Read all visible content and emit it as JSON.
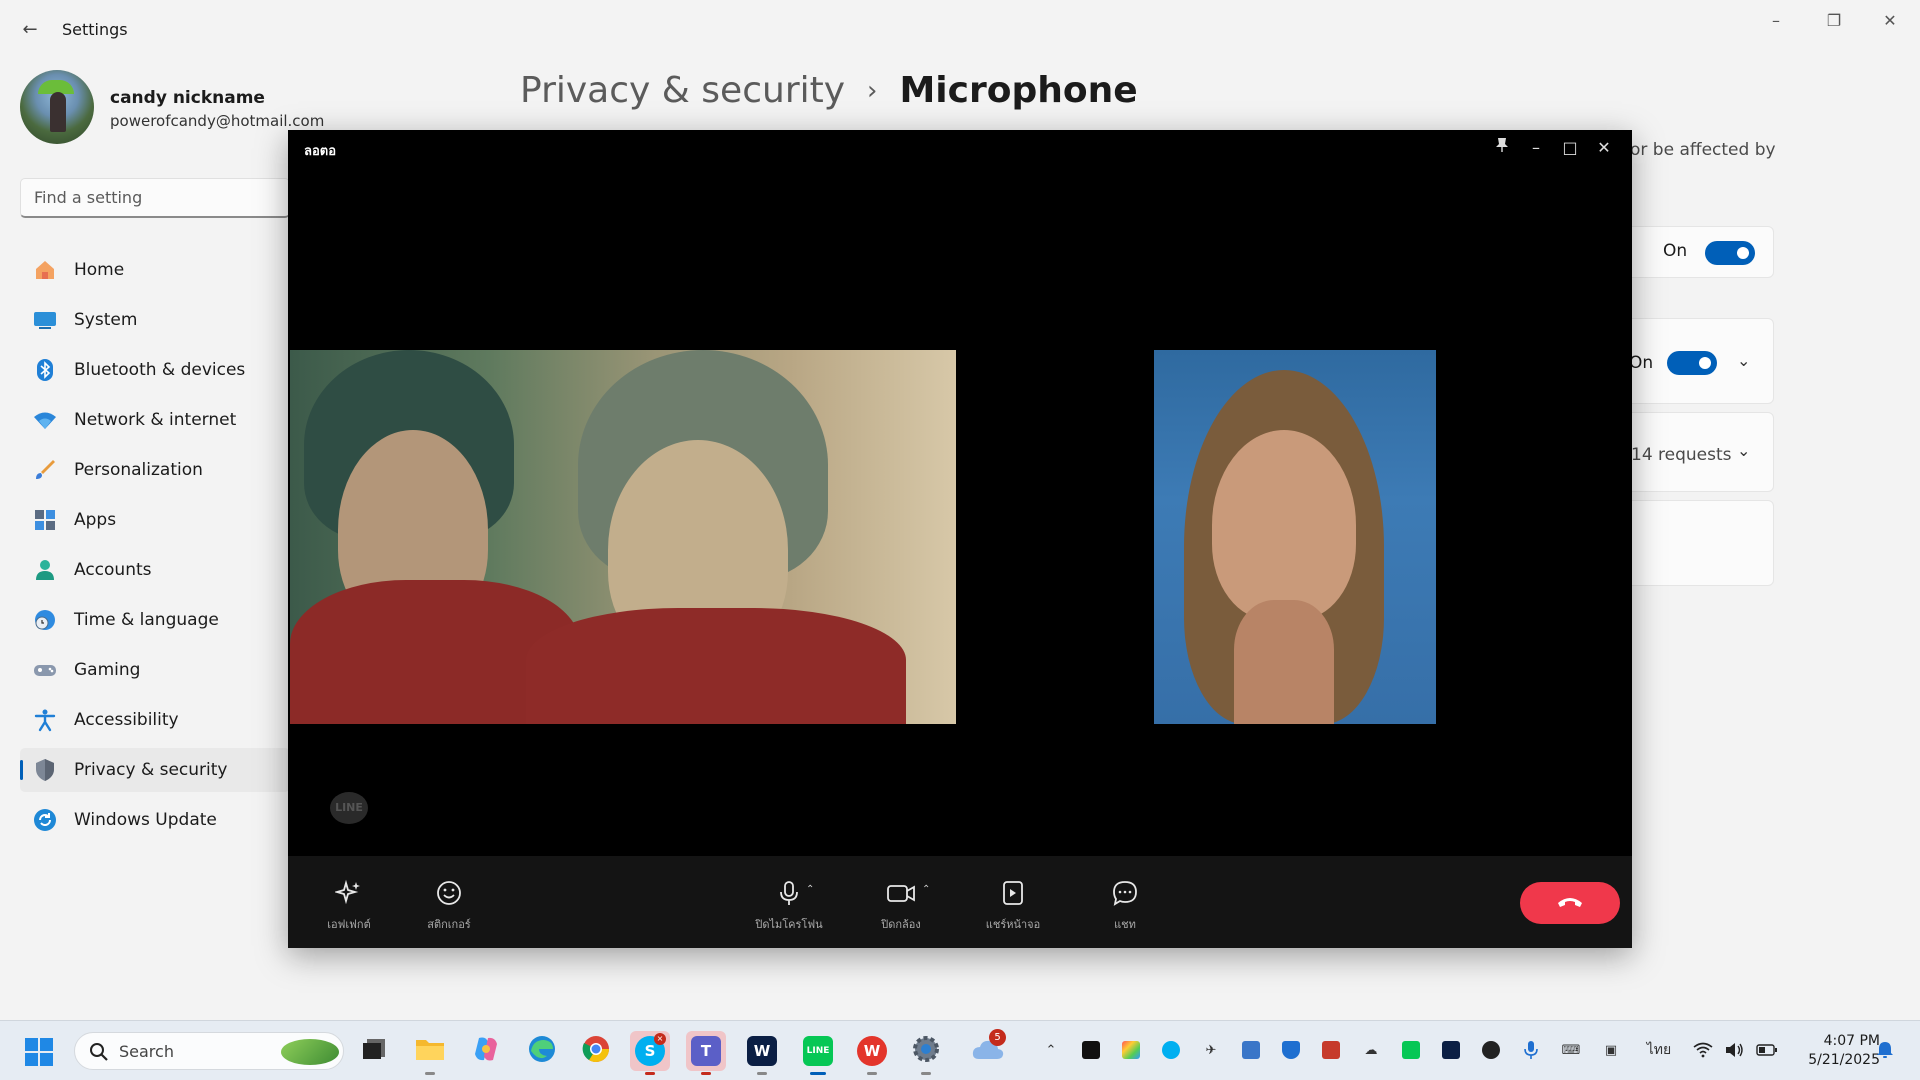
{
  "settings": {
    "app_title": "Settings",
    "profile": {
      "name": "candy nickname",
      "email": "powerofcandy@hotmail.com"
    },
    "search": {
      "placeholder": "Find a setting"
    },
    "nav": [
      {
        "label": "Home",
        "icon": "home-icon"
      },
      {
        "label": "System",
        "icon": "system-icon"
      },
      {
        "label": "Bluetooth & devices",
        "icon": "bluetooth-icon"
      },
      {
        "label": "Network & internet",
        "icon": "wifi-icon"
      },
      {
        "label": "Personalization",
        "icon": "brush-icon"
      },
      {
        "label": "Apps",
        "icon": "apps-icon"
      },
      {
        "label": "Accounts",
        "icon": "person-icon"
      },
      {
        "label": "Time & language",
        "icon": "globe-clock-icon"
      },
      {
        "label": "Gaming",
        "icon": "gamepad-icon"
      },
      {
        "label": "Accessibility",
        "icon": "accessibility-icon"
      },
      {
        "label": "Privacy & security",
        "icon": "shield-icon",
        "active": true
      },
      {
        "label": "Windows Update",
        "icon": "update-icon"
      }
    ],
    "breadcrumb": {
      "parent": "Privacy & security",
      "current": "Microphone"
    },
    "content": {
      "description_fragment": "or be affected by",
      "row1_state": "On",
      "row2_state": "On",
      "row3_text": "14 requests"
    }
  },
  "call": {
    "title": "ลอตอ",
    "controls": [
      {
        "label": "เอฟเฟกต์",
        "icon": "sparkle-icon"
      },
      {
        "label": "สติกเกอร์",
        "icon": "smiley-icon"
      },
      {
        "label": "ปิดไมโครโฟน",
        "icon": "microphone-icon"
      },
      {
        "label": "ปิดกล้อง",
        "icon": "camera-icon"
      },
      {
        "label": "แชร์หน้าจอ",
        "icon": "screen-share-icon"
      },
      {
        "label": "แชท",
        "icon": "chat-icon"
      }
    ],
    "logo_text": "LINE",
    "end_call_color": "#f0384b"
  },
  "taskbar": {
    "search_label": "Search",
    "apps": [
      {
        "name": "task-view"
      },
      {
        "name": "file-explorer"
      },
      {
        "name": "copilot"
      },
      {
        "name": "edge"
      },
      {
        "name": "chrome"
      },
      {
        "name": "skype"
      },
      {
        "name": "teams"
      },
      {
        "name": "webex"
      },
      {
        "name": "line"
      },
      {
        "name": "wps-office"
      },
      {
        "name": "settings"
      },
      {
        "name": "weather",
        "badge": "5"
      }
    ],
    "language": "ไทย",
    "time": "4:07 PM",
    "date": "5/21/2025"
  },
  "colors": {
    "accent": "#005fb8",
    "end_call": "#f0384b",
    "line_green": "#06c755"
  }
}
